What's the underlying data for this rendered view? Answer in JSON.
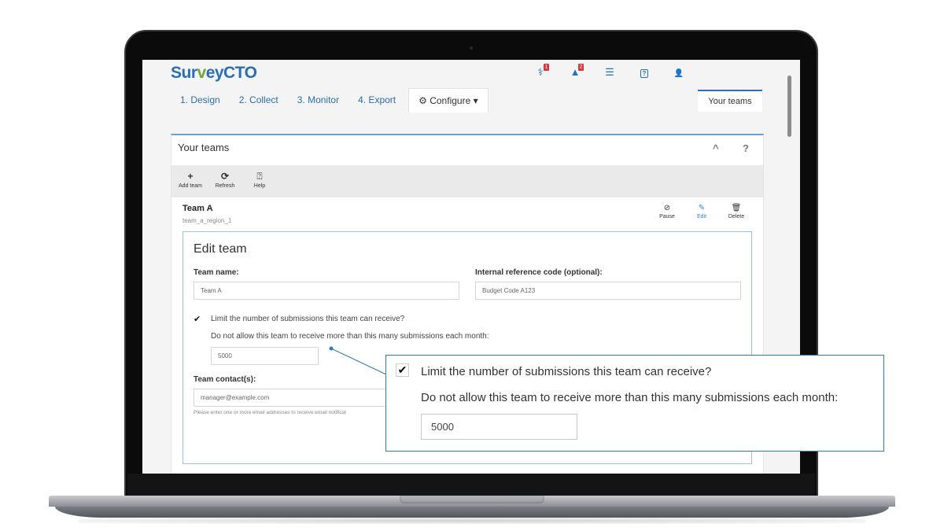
{
  "app": {
    "logo_part1": "Sur",
    "logo_part2": "v",
    "logo_part3": "eyCTO"
  },
  "top_icons": [
    {
      "name": "diagnostics",
      "glyph": "⚕",
      "badge": "1"
    },
    {
      "name": "warnings",
      "glyph": "▲",
      "badge": "2"
    },
    {
      "name": "server-list",
      "glyph": "☰",
      "badge": null
    },
    {
      "name": "help",
      "glyph": "?",
      "badge": null
    },
    {
      "name": "user",
      "glyph": "👤",
      "badge": null
    }
  ],
  "nav": {
    "tabs": [
      "1. Design",
      "2. Collect",
      "3. Monitor",
      "4. Export"
    ],
    "configure": "⚙ Configure ▾",
    "right_tab": "Your teams"
  },
  "panel": {
    "title": "Your teams",
    "collapse": "^",
    "help": "?",
    "toolbar": [
      {
        "icon": "+",
        "label": "Add team"
      },
      {
        "icon": "⟳",
        "label": "Refresh"
      },
      {
        "icon": "⍰",
        "label": "Help"
      }
    ]
  },
  "team": {
    "name": "Team A",
    "id": "team_a_region_1",
    "actions": [
      {
        "icon": "⊘",
        "label": "Pause"
      },
      {
        "icon": "✎",
        "label": "Edit"
      },
      {
        "icon": "🗑",
        "label": "Delete"
      }
    ]
  },
  "edit_form": {
    "title": "Edit team",
    "team_name_label": "Team name:",
    "team_name_value": "Team A",
    "ref_code_label": "Internal reference code (optional):",
    "ref_code_value": "Budget Code A123",
    "limit_checkbox_checked": true,
    "limit_label": "Limit the number of submissions this team can receive?",
    "limit_desc": "Do not allow this team to receive more than this many submissions each month:",
    "limit_value": "5000",
    "contacts_label": "Team contact(s):",
    "contacts_value": "manager@example.com",
    "contacts_help": "Please enter one or more email addresses to receive email notificat"
  },
  "callout": {
    "checked": "✔",
    "limit_label": "Limit the number of submissions this team can receive?",
    "limit_desc": "Do not allow this team to receive more than this many submissions each month:",
    "limit_value": "5000"
  }
}
